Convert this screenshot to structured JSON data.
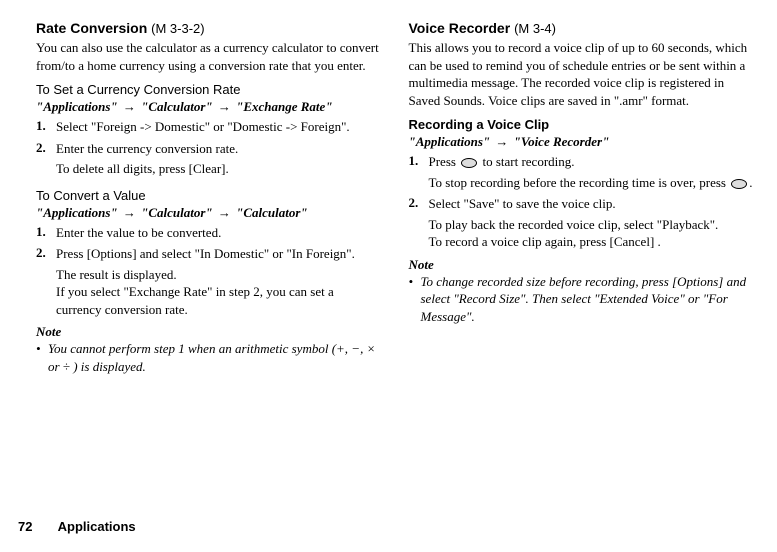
{
  "left": {
    "title": "Rate Conversion",
    "code": "(M 3-3-2)",
    "intro": "You can also use the calculator as a currency calculator to convert from/to a home currency using a conversion rate that you enter.",
    "set_rate_heading": "To Set a Currency Conversion Rate",
    "set_rate_path1": "\"Applications\"",
    "set_rate_path2": "\"Calculator\"",
    "set_rate_path3": "\"Exchange Rate\"",
    "set_rate_step1": "Select \"Foreign -> Domestic\" or \"Domestic -> Foreign\".",
    "set_rate_step2": "Enter the currency conversion rate.",
    "set_rate_step2_sub": "To delete all digits, press [Clear].",
    "convert_heading": "To Convert a Value",
    "convert_path1": "\"Applications\"",
    "convert_path2": "\"Calculator\"",
    "convert_path3": "\"Calculator\"",
    "convert_step1": "Enter the value to be converted.",
    "convert_step2": "Press [Options] and select \"In Domestic\" or \"In Foreign\".",
    "convert_step2_suba": "The result is displayed.",
    "convert_step2_subb": "If you select \"Exchange Rate\" in step 2, you can set a currency conversion rate.",
    "note_label": "Note",
    "note_text": "You cannot perform step 1 when an arithmetic symbol (+, −, × or ÷ ) is displayed."
  },
  "right": {
    "title": "Voice Recorder",
    "code": "(M 3-4)",
    "intro": "This allows you to record a voice clip of up to 60 seconds, which can be used to remind you of schedule entries or be sent within a multimedia message. The recorded voice clip is registered in Saved Sounds. Voice clips are saved in \".amr\" format.",
    "rec_heading": "Recording a Voice Clip",
    "rec_path1": "\"Applications\"",
    "rec_path2": "\"Voice Recorder\"",
    "rec_step1_a": "Press ",
    "rec_step1_b": " to start recording.",
    "rec_step1_sub_a": "To stop recording before the recording time is over, press ",
    "rec_step1_sub_b": ".",
    "rec_step2": "Select \"Save\" to save the voice clip.",
    "rec_step2_sub_a": "To play back the recorded voice clip, select \"Playback\".",
    "rec_step2_sub_b": "To record a voice clip again, press [Cancel] .",
    "note_label": "Note",
    "note_text": "To change recorded size before recording, press [Options] and select \"Record Size\". Then select \"Extended Voice\" or \"For Message\"."
  },
  "footer": {
    "page": "72",
    "section": "Applications"
  }
}
